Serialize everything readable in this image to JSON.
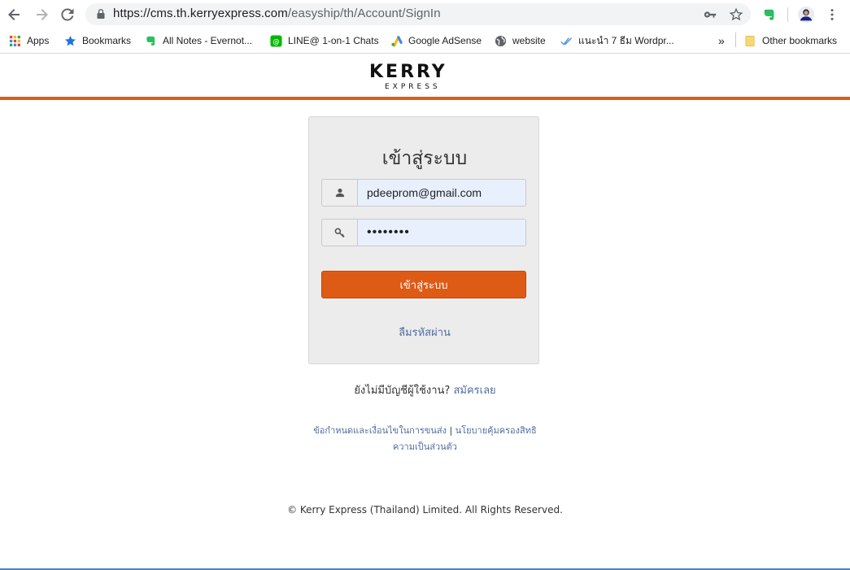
{
  "browser": {
    "url_host": "https://cms.th.kerryexpress.com",
    "url_path": "/easyship/th/Account/SignIn",
    "icons": {
      "back": "arrow-left-icon",
      "forward": "arrow-right-icon",
      "reload": "reload-icon",
      "lock": "lock-icon",
      "key": "key-icon",
      "star": "star-icon",
      "evernote": "evernote-icon",
      "profile": "avatar-icon",
      "menu": "kebab-menu-icon"
    },
    "bookmarks": [
      {
        "label": "Apps",
        "icon": "apps-grid-icon"
      },
      {
        "label": "Bookmarks",
        "icon": "star-icon"
      },
      {
        "label": "All Notes - Evernot...",
        "icon": "evernote-icon"
      },
      {
        "label": "LINE@ 1-on-1 Chats",
        "icon": "line-icon"
      },
      {
        "label": "Google AdSense",
        "icon": "adsense-icon"
      },
      {
        "label": "website",
        "icon": "globe-icon"
      },
      {
        "label": "แนะนำ 7 ธีม Wordpr...",
        "icon": "check-icon"
      }
    ],
    "overflow": "»",
    "other_bookmarks": "Other bookmarks"
  },
  "header": {
    "logo_main": "KERRY",
    "logo_sub": "EXPRESS",
    "accent_color": "#c9622b"
  },
  "login": {
    "title": "เข้าสู่ระบบ",
    "username_value": "pdeeprom@gmail.com",
    "password_value": "••••••••",
    "submit_label": "เข้าสู่ระบบ",
    "forgot_label": "ลืมรหัสผ่าน",
    "button_color": "#de5b16"
  },
  "register": {
    "prompt": "ยังไม่มีบัญชีผู้ใช้งาน?",
    "link": "สมัครเลย"
  },
  "footer": {
    "terms_link": "ข้อกำหนดและเงื่อนไขในการขนส่ง",
    "separator": "|",
    "privacy_link_line1": "นโยบายคุ้มครองสิทธิ",
    "privacy_link_line2": "ความเป็นส่วนตัว",
    "copyright": "© Kerry Express (Thailand) Limited. All Rights Reserved."
  }
}
